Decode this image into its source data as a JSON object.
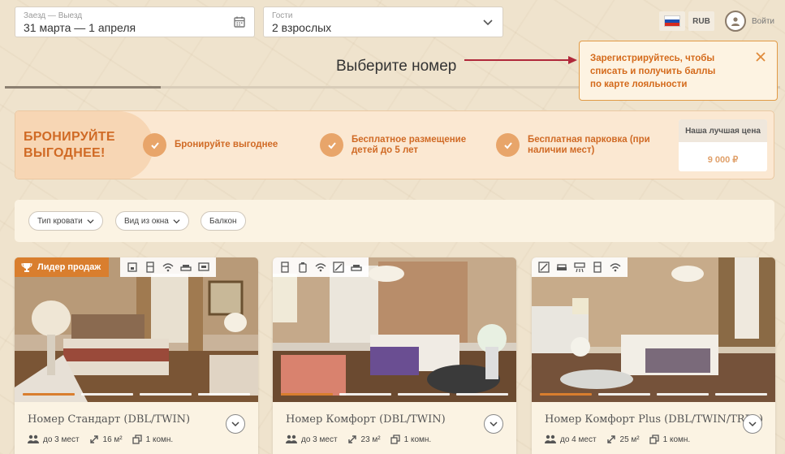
{
  "search": {
    "dates_label": "Заезд — Выезд",
    "dates_value": "31 марта — 1 апреля",
    "guests_label": "Гости",
    "guests_value": "2 взрослых"
  },
  "header": {
    "currency": "RUB",
    "login": "Войти"
  },
  "page_title": "Выберите номер",
  "tooltip": {
    "text": "Зарегистрируйтесь, чтобы списать и получить баллы по карте лояльности"
  },
  "promo": {
    "title_line1": "БРОНИРУЙТЕ",
    "title_line2": "ВЫГОДНЕЕ!",
    "benefits": [
      "Бронируйте выгоднее",
      "Бесплатное размещение детей до 5 лет",
      "Бесплатная парковка (при наличии мест)"
    ],
    "best_price_label": "Наша лучшая цена",
    "best_price_value": "9 000 ₽"
  },
  "filters": [
    "Тип кровати",
    "Вид из окна",
    "Балкон"
  ],
  "rooms": [
    {
      "name": "Номер Стандарт (DBL/TWIN)",
      "badge": "Лидер продаж",
      "guests": "до 3 мест",
      "area": "16 м²",
      "rooms": "1 комн."
    },
    {
      "name": "Номер Комфорт (DBL/TWIN)",
      "guests": "до 3 мест",
      "area": "23 м²",
      "rooms": "1 комн."
    },
    {
      "name": "Номер Комфорт Plus (DBL/TWIN/TRPL)",
      "guests": "до 4 мест",
      "area": "25 м²",
      "rooms": "1 комн."
    }
  ],
  "colors": {
    "accent": "#d97e2e",
    "promo_bg": "#fbe8d2",
    "page_bg": "#efe3cd",
    "tooltip_border": "#e19a45"
  }
}
